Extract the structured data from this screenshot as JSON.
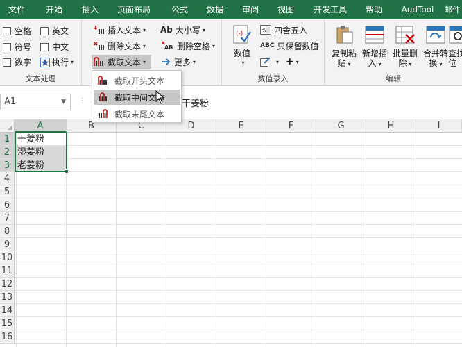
{
  "ribbon_tabs": [
    "文件",
    "开始",
    "插入",
    "页面布局",
    "公式",
    "数据",
    "审阅",
    "视图",
    "开发工具",
    "帮助",
    "AudTool",
    "邮件"
  ],
  "text_group": {
    "label": "文本处理",
    "checkboxes": [
      "空格",
      "英文",
      "符号",
      "中文",
      "数字"
    ],
    "execute_label": "执行"
  },
  "text_buttons": {
    "insert": "插入文本",
    "delete": "删除文本",
    "extract": "截取文本",
    "case": "大小写",
    "delete_spaces": "删除空格",
    "more": "更多"
  },
  "numeric_group": {
    "label": "数值录入",
    "big_button": "数值",
    "round": "四舍五入",
    "keep_numeric": "只保留数值"
  },
  "edit_group": {
    "label": "编辑",
    "buttons": [
      {
        "line1": "复制粘",
        "line2": "贴"
      },
      {
        "line1": "新增插",
        "line2": "入"
      },
      {
        "line1": "批量删",
        "line2": "除"
      },
      {
        "line1": "合并转",
        "line2": "换"
      },
      {
        "line1": "查找",
        "line2": "位"
      }
    ]
  },
  "extract_menu": {
    "items": [
      "截取开头文本",
      "截取中间文本",
      "截取末尾文本"
    ],
    "hovered_index": 1
  },
  "formula_bar": {
    "name_box": "A1",
    "content": "干姜粉"
  },
  "sheet": {
    "columns": [
      "A",
      "B",
      "C",
      "D",
      "E",
      "F",
      "G",
      "H",
      "I"
    ],
    "rows": [
      "1",
      "2",
      "3",
      "4",
      "5",
      "6",
      "7",
      "8",
      "9",
      "10",
      "11",
      "12",
      "13",
      "14",
      "15",
      "16"
    ],
    "cells": [
      "干姜粉",
      "湿姜粉",
      "老姜粉"
    ]
  },
  "colors": {
    "ribbon_green": "#217346",
    "selection_gray": "#d8d8d8"
  }
}
